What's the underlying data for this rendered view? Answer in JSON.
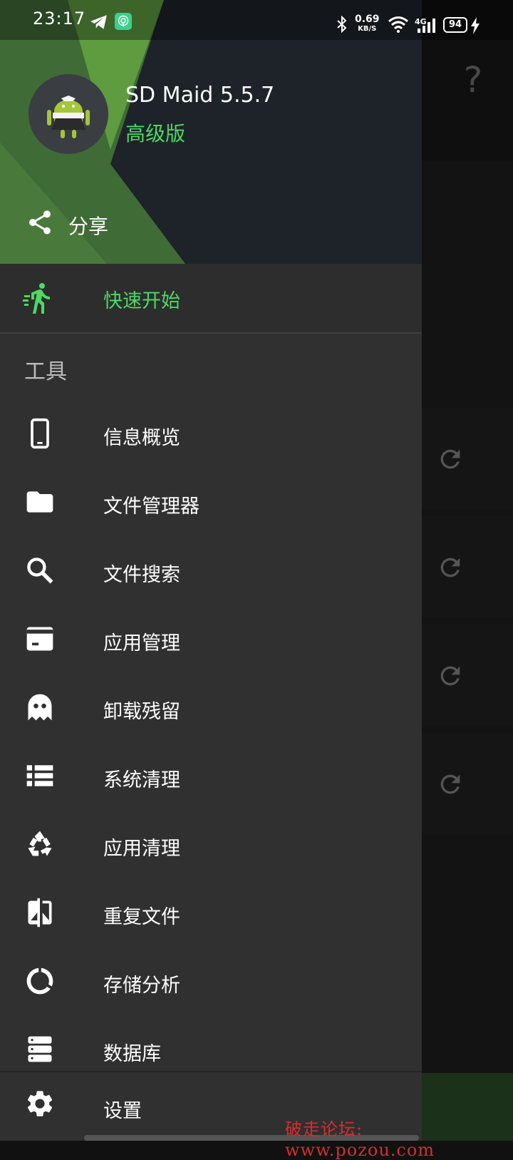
{
  "status_bar": {
    "time": "23:17",
    "speed_value": "0.69",
    "speed_unit": "KB/S",
    "network": "4G",
    "battery": "94"
  },
  "drawer": {
    "app_name": "SD Maid 5.5.7",
    "app_tier": "高级版",
    "share_label": "分享",
    "quick_start": "快速开始",
    "section_title": "工具",
    "items": [
      {
        "label": "信息概览",
        "icon": "phone-icon"
      },
      {
        "label": "文件管理器",
        "icon": "folder-icon"
      },
      {
        "label": "文件搜索",
        "icon": "search-icon"
      },
      {
        "label": "应用管理",
        "icon": "app-box-icon"
      },
      {
        "label": "卸载残留",
        "icon": "ghost-icon"
      },
      {
        "label": "系统清理",
        "icon": "list-icon"
      },
      {
        "label": "应用清理",
        "icon": "recycle-icon"
      },
      {
        "label": "重复文件",
        "icon": "duplicate-icon"
      },
      {
        "label": "存储分析",
        "icon": "pie-icon"
      },
      {
        "label": "数据库",
        "icon": "database-icon"
      }
    ],
    "settings": "设置"
  },
  "background": {
    "help": "?"
  },
  "watermark": "破走论坛: www.pozou.com",
  "colors": {
    "accent": "#4cd964",
    "drawer_bg": "#303030",
    "header_bg": "#1e2229"
  }
}
